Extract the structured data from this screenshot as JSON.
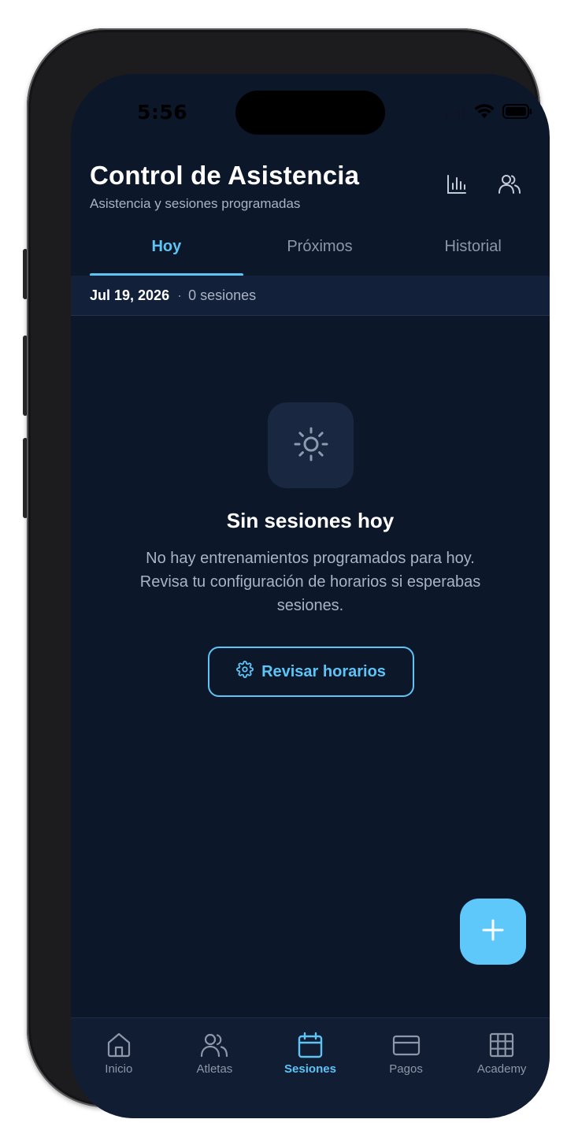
{
  "status_bar": {
    "time": "5:56"
  },
  "header": {
    "title": "Control de Asistencia",
    "subtitle": "Asistencia y sesiones programadas",
    "stats_icon": "bar-chart-icon",
    "team_icon": "users-icon"
  },
  "tabs": [
    {
      "label": "Hoy",
      "active": true
    },
    {
      "label": "Próximos",
      "active": false
    },
    {
      "label": "Historial",
      "active": false
    }
  ],
  "date_bar": {
    "date": "Jul 19, 2026",
    "separator": "·",
    "count": "0 sesiones"
  },
  "empty_state": {
    "icon": "sun-icon",
    "title": "Sin sesiones hoy",
    "description": "No hay entrenamientos programados para hoy. Revisa tu configuración de horarios si esperabas sesiones.",
    "button_label": "Revisar horarios",
    "button_icon": "gear-icon"
  },
  "fab": {
    "icon": "plus-icon"
  },
  "bottom_nav": [
    {
      "label": "Inicio",
      "icon": "home-icon",
      "active": false
    },
    {
      "label": "Atletas",
      "icon": "users-icon",
      "active": false
    },
    {
      "label": "Sesiones",
      "icon": "calendar-icon",
      "active": true
    },
    {
      "label": "Pagos",
      "icon": "credit-card-icon",
      "active": false
    },
    {
      "label": "Academy",
      "icon": "grid-icon",
      "active": false
    }
  ],
  "colors": {
    "background": "#0c172a",
    "accent": "#5ec3f5",
    "text_primary": "#ffffff",
    "text_secondary": "#a9b3c4",
    "nav_background": "#111d33"
  }
}
